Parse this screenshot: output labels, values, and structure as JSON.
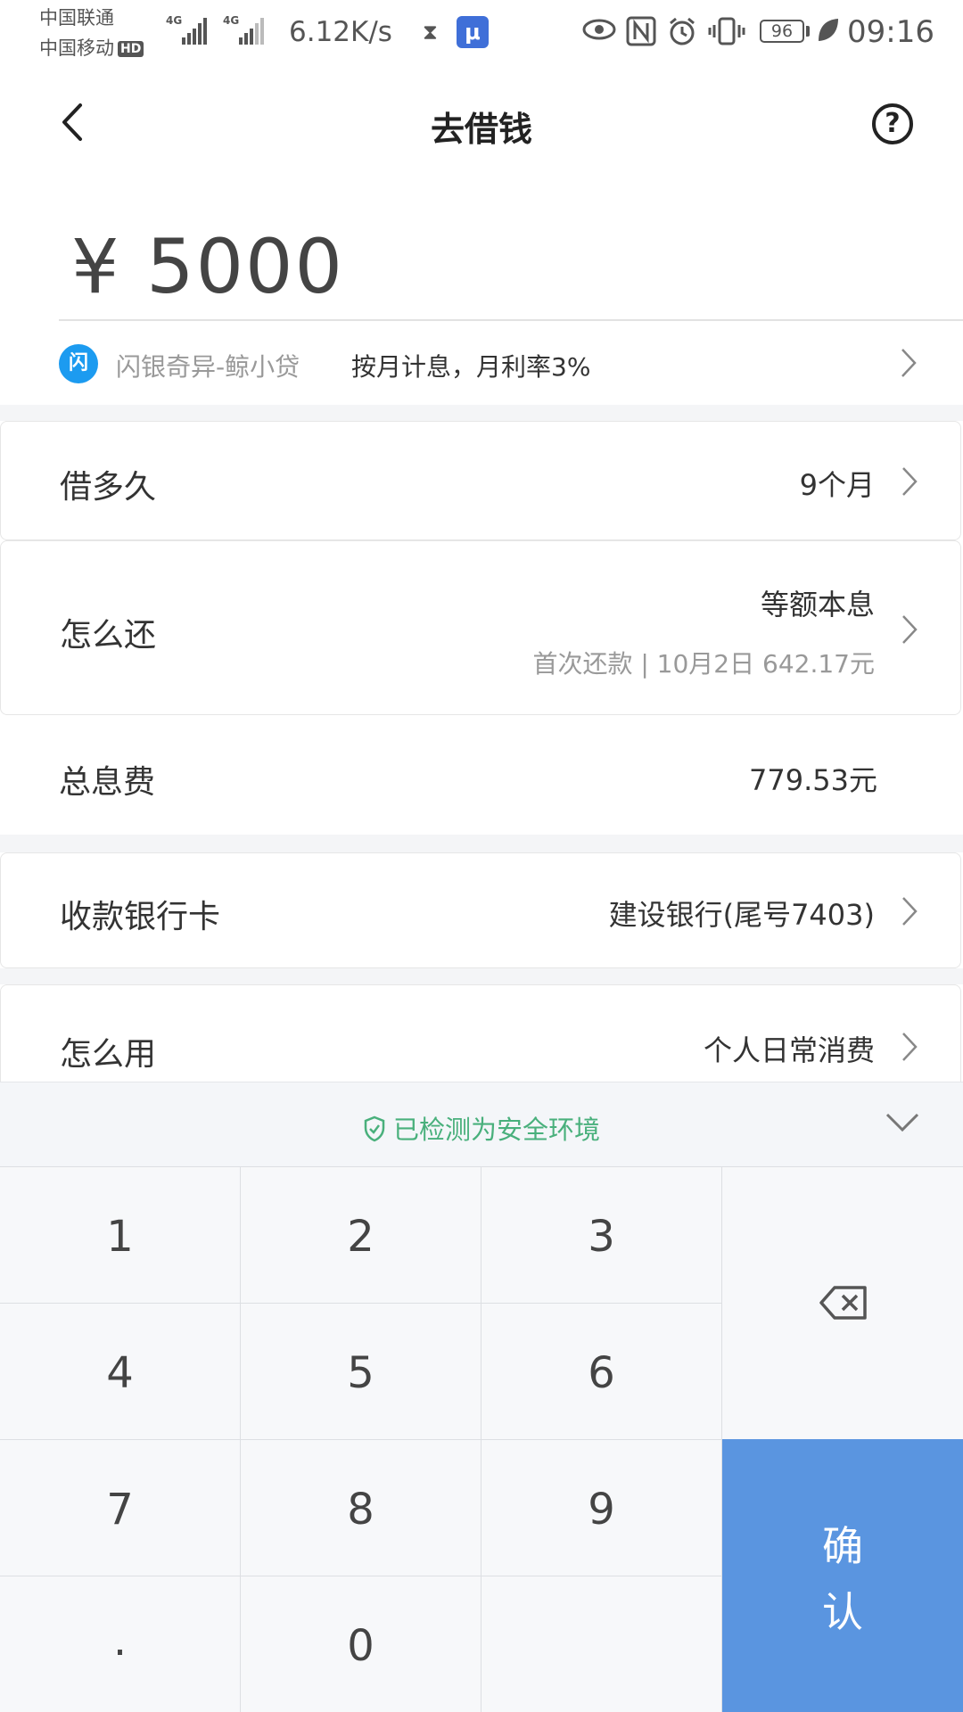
{
  "status_bar": {
    "carrier1": "中国联通",
    "carrier2": "中国移动",
    "hd_badge": "HD",
    "signal1_tag": "4G",
    "signal2_tag": "4G",
    "net_speed": "6.12K/s",
    "battery": "96",
    "time": "09:16"
  },
  "header": {
    "title": "去借钱"
  },
  "loan": {
    "amount": "¥ 5000",
    "lender_logo": "闪",
    "lender_name": "闪银奇异-鲸小贷",
    "rate_text": "按月计息，月利率3%"
  },
  "rows": {
    "duration": {
      "label": "借多久",
      "value": "9个月"
    },
    "repay": {
      "label": "怎么还",
      "value": "等额本息",
      "sub": "首次还款 | 10月2日 642.17元"
    },
    "interest": {
      "label": "总息费",
      "value": "779.53元"
    },
    "bank": {
      "label": "收款银行卡",
      "value": "建设银行(尾号7403)"
    },
    "usage": {
      "label": "怎么用",
      "value": "个人日常消费"
    }
  },
  "keyboard": {
    "secure_text": "已检测为安全环境",
    "keys": [
      "1",
      "2",
      "3",
      "4",
      "5",
      "6",
      "7",
      "8",
      "9",
      ".",
      "0"
    ],
    "confirm_line1": "确",
    "confirm_line2": "认"
  },
  "colors": {
    "confirm_bg": "#5a95e0",
    "secure_green": "#49b07c",
    "lender_logo_blue": "#1c9bf0"
  }
}
